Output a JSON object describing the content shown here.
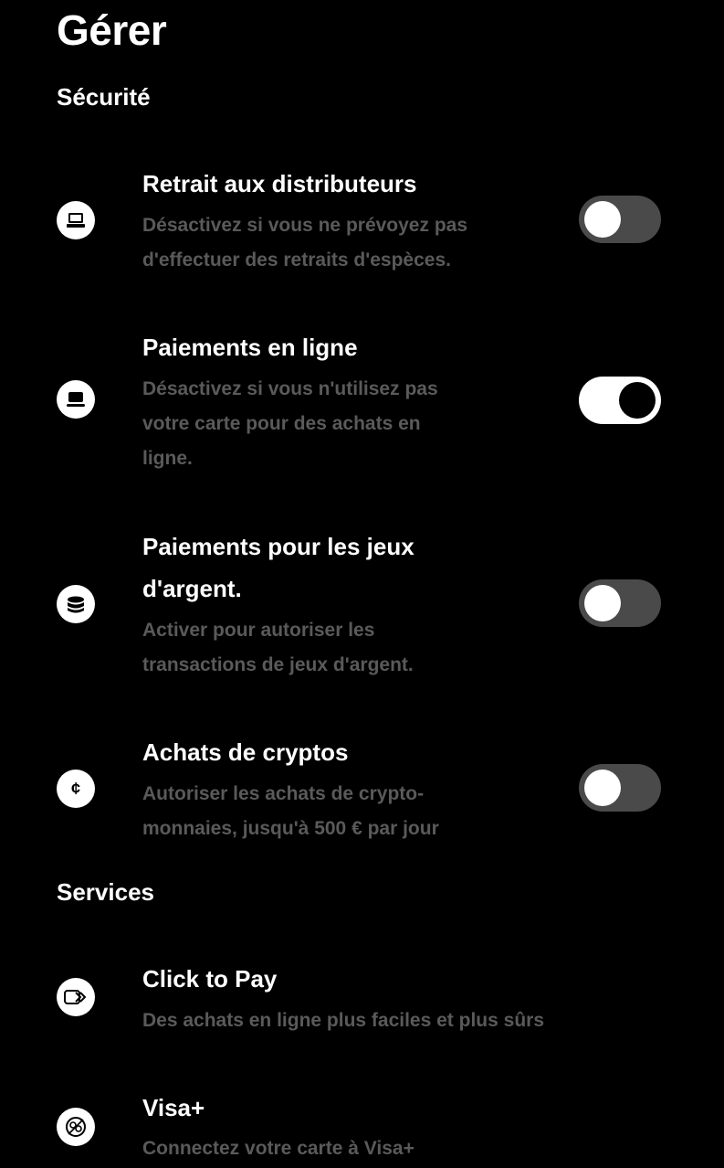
{
  "page": {
    "title": "Gérer"
  },
  "security": {
    "title": "Sécurité",
    "items": [
      {
        "title_lines": [
          "Retrait aux distributeurs"
        ],
        "desc_lines": [
          "Désactivez si vous ne prévoyez pas",
          "d'effectuer des retraits d'espèces."
        ],
        "icon": "atm-icon",
        "enabled": false
      },
      {
        "title_lines": [
          "Paiements en ligne"
        ],
        "desc_lines": [
          "Désactivez si vous n'utilisez pas",
          "votre carte pour des achats en",
          "ligne."
        ],
        "icon": "laptop-icon",
        "enabled": true
      },
      {
        "title_lines": [
          "Paiements pour les jeux",
          "d'argent."
        ],
        "desc_lines": [
          "Activer pour autoriser les",
          "transactions de jeux d'argent."
        ],
        "icon": "coins-icon",
        "enabled": false
      },
      {
        "title_lines": [
          "Achats de cryptos"
        ],
        "desc_lines": [
          "Autoriser les achats de crypto-",
          "monnaies, jusqu'à 500 € par jour"
        ],
        "icon": "crypto-icon",
        "enabled": false
      }
    ]
  },
  "services": {
    "title": "Services",
    "items": [
      {
        "title": "Click to Pay",
        "desc": "Des achats en ligne plus faciles et plus sûrs",
        "icon": "click-to-pay-icon"
      },
      {
        "title": "Visa+",
        "desc": "Connectez votre carte à Visa+",
        "icon": "visa-plus-icon"
      }
    ]
  }
}
